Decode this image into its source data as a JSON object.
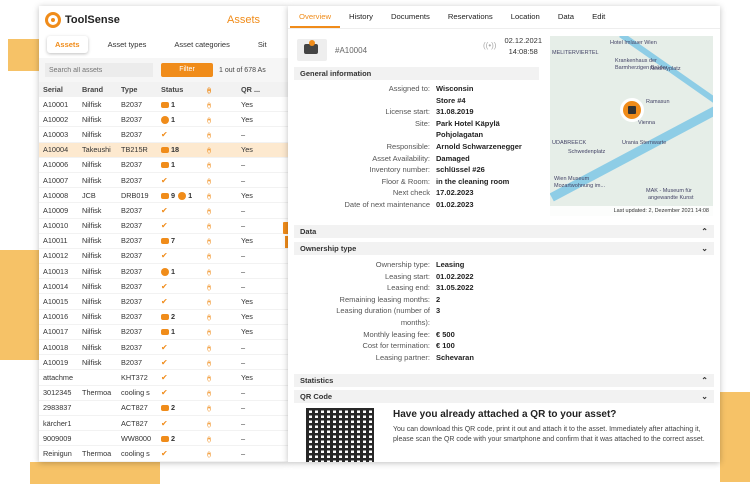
{
  "app": {
    "brand": "ToolSense",
    "panel_title": "Assets",
    "close_glyph": "✕",
    "accent": "#f08c1a"
  },
  "left": {
    "tabs": [
      "Assets",
      "Asset types",
      "Asset categories",
      "Sit"
    ],
    "search_placeholder": "Search all assets",
    "filter_label": "Filter",
    "count_text": "1 out of 678 As",
    "columns": [
      "Serial",
      "Brand",
      "Type",
      "Status",
      "(•)",
      "QR ..."
    ],
    "rows": [
      {
        "serial": "A10001",
        "brand": "Nilfisk",
        "type": "B2037",
        "status": "1",
        "status_icon": "tag-icon",
        "qr": "Yes"
      },
      {
        "serial": "A10002",
        "brand": "Nilfisk",
        "type": "B2037",
        "status": "1",
        "status_icon": "gauge-icon",
        "qr": "Yes"
      },
      {
        "serial": "A10003",
        "brand": "Nilfisk",
        "type": "B2037",
        "status": "✔",
        "status_icon": "check-icon",
        "qr": "–"
      },
      {
        "serial": "A10004",
        "brand": "Takeushi",
        "type": "TB215R",
        "status": "18",
        "status_icon": "tag-icon",
        "qr": "Yes",
        "selected": true
      },
      {
        "serial": "A10006",
        "brand": "Nilfisk",
        "type": "B2037",
        "status": "1",
        "status_icon": "tag-icon",
        "qr": "–"
      },
      {
        "serial": "A10007",
        "brand": "Nilfisk",
        "type": "B2037",
        "status": "✔",
        "status_icon": "check-icon",
        "qr": "–"
      },
      {
        "serial": "A10008",
        "brand": "JCB",
        "type": "DRB019",
        "status": "9",
        "status2": "1",
        "status_icon": "tag-icon",
        "qr": "Yes"
      },
      {
        "serial": "A10009",
        "brand": "Nilfisk",
        "type": "B2037",
        "status": "✔",
        "status_icon": "check-icon",
        "qr": "–"
      },
      {
        "serial": "A10010",
        "brand": "Nilfisk",
        "type": "B2037",
        "status": "✔",
        "status_icon": "check-icon",
        "qr": "–"
      },
      {
        "serial": "A10011",
        "brand": "Nilfisk",
        "type": "B2037",
        "status": "7",
        "status_icon": "tag-icon",
        "qr": "Yes"
      },
      {
        "serial": "A10012",
        "brand": "Nilfisk",
        "type": "B2037",
        "status": "✔",
        "status_icon": "check-icon",
        "qr": "–"
      },
      {
        "serial": "A10013",
        "brand": "Nilfisk",
        "type": "B2037",
        "status": "1",
        "status_icon": "gauge-icon",
        "qr": "–"
      },
      {
        "serial": "A10014",
        "brand": "Nilfisk",
        "type": "B2037",
        "status": "✔",
        "status_icon": "check-icon",
        "qr": "–"
      },
      {
        "serial": "A10015",
        "brand": "Nilfisk",
        "type": "B2037",
        "status": "✔",
        "status_icon": "check-icon",
        "qr": "Yes"
      },
      {
        "serial": "A10016",
        "brand": "Nilfisk",
        "type": "B2037",
        "status": "2",
        "status_icon": "tag-icon",
        "qr": "Yes"
      },
      {
        "serial": "A10017",
        "brand": "Nilfisk",
        "type": "B2037",
        "status": "1",
        "status_icon": "tag-icon",
        "qr": "Yes"
      },
      {
        "serial": "A10018",
        "brand": "Nilfisk",
        "type": "B2037",
        "status": "✔",
        "status_icon": "check-icon",
        "qr": "–"
      },
      {
        "serial": "A10019",
        "brand": "Nilfisk",
        "type": "B2037",
        "status": "✔",
        "status_icon": "check-icon",
        "qr": "–"
      },
      {
        "serial": "attachme",
        "brand": "",
        "type": "KHT372",
        "status": "✔",
        "status_icon": "check-icon",
        "qr": "Yes"
      },
      {
        "serial": "3012345",
        "brand": "Thermoa",
        "type": "cooling s",
        "status": "✔",
        "status_icon": "check-icon",
        "qr": "–"
      },
      {
        "serial": "2983837",
        "brand": "",
        "type": "ACT827",
        "status": "2",
        "status_icon": "edit-icon",
        "qr": "–"
      },
      {
        "serial": "kärcher1",
        "brand": "",
        "type": "ACT827",
        "status": "✔",
        "status_icon": "check-icon",
        "qr": "–"
      },
      {
        "serial": "9009009",
        "brand": "",
        "type": "WW8000",
        "status": "2",
        "status_icon": "tag-icon",
        "qr": "–"
      },
      {
        "serial": "Reinigun",
        "brand": "Thermoa",
        "type": "cooling s",
        "status": "✔",
        "status_icon": "check-icon",
        "qr": "–"
      },
      {
        "serial": "attachme",
        "brand": "Thermoa",
        "type": "cooling s",
        "status": "✔",
        "status_icon": "check-icon",
        "qr": "–"
      }
    ]
  },
  "right": {
    "tabs": [
      "Overview",
      "History",
      "Documents",
      "Reservations",
      "Location",
      "Data",
      "Edit"
    ],
    "asset_id": "#A10004",
    "date": "02.12.2021",
    "time": "14:08:58",
    "general_title": "General information",
    "general": [
      {
        "k": "Assigned to:",
        "v": "Wisconsin"
      },
      {
        "k": "",
        "v": "Store #4"
      },
      {
        "k": "License start:",
        "v": "31.08.2019"
      },
      {
        "k": "Site:",
        "v": "Park Hotel Käpylä"
      },
      {
        "k": "",
        "v": "Pohjolagatan"
      },
      {
        "k": "Responsible:",
        "v": "Arnold Schwarzenegger"
      },
      {
        "k": "Asset Availability:",
        "v": "Damaged"
      },
      {
        "k": "Inventory number:",
        "v": "schlüssel #26"
      },
      {
        "k": "Floor & Room:",
        "v": "in the cleaning room"
      },
      {
        "k": "Next check",
        "v": "17.02.2023"
      },
      {
        "k": "Date of next maintenance",
        "v": "01.02.2023"
      }
    ],
    "map": {
      "labels": [
        "Hotel Imlauer Wien",
        "MELITERVIERTEL",
        "Krankenhaus der",
        "Barmherzigen Brüder",
        "Nestroyplatz",
        "Ramasun",
        "Vienna",
        "Urania Sternwarte",
        "UDABREECK",
        "Schwedenplatz",
        "Wien Museum",
        "Mozartwohnung im...",
        "MAK - Museum für",
        "angewandte Kunst"
      ],
      "caption": "Last updated: 2, Dezember 2021 14:08"
    },
    "data_title": "Data",
    "ownership_title": "Ownership type",
    "ownership": [
      {
        "k": "Ownership type:",
        "v": "Leasing"
      },
      {
        "k": "Leasing start:",
        "v": "01.02.2022"
      },
      {
        "k": "Leasing end:",
        "v": "31.05.2022"
      },
      {
        "k": "Remaining leasing months:",
        "v": "2"
      },
      {
        "k": "Leasing duration (number of",
        "v": "3"
      },
      {
        "k": "months):",
        "v": ""
      },
      {
        "k": "Monthly leasing fee:",
        "v": "€ 500"
      },
      {
        "k": "Cost for termination:",
        "v": "€ 100"
      },
      {
        "k": "Leasing partner:",
        "v": "Schevaran"
      }
    ],
    "statistics_title": "Statistics",
    "qr_title": "QR Code",
    "qr_heading": "Have you already attached a QR to your asset?",
    "qr_text": "You can download this QR code, print it out and attach it to the asset. Immediately after attaching it, please scan the QR code with your smartphone and confirm that it was attached to the correct asset."
  }
}
